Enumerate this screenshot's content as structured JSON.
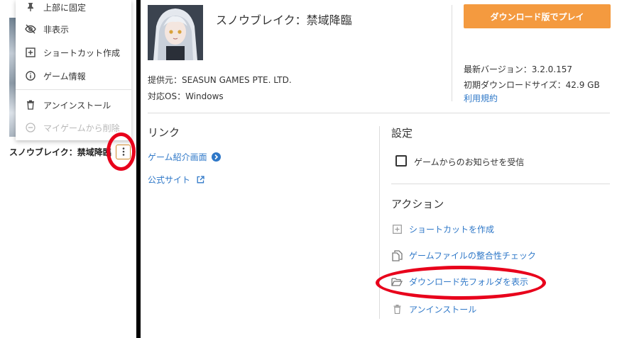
{
  "context_menu": {
    "items": [
      {
        "label": "上部に固定",
        "icon": "pin-icon",
        "disabled": false
      },
      {
        "label": "非表示",
        "icon": "eye-off-icon",
        "disabled": false
      },
      {
        "label": "ショートカット作成",
        "icon": "plus-square-icon",
        "disabled": false
      },
      {
        "label": "ゲーム情報",
        "icon": "info-icon",
        "disabled": false
      },
      {
        "label": "アンインストール",
        "icon": "trash-icon",
        "disabled": false
      },
      {
        "label": "マイゲームから削除",
        "icon": "minus-circle-icon",
        "disabled": true
      }
    ]
  },
  "sidebar": {
    "game_name": "スノウブレイク：禁域降臨",
    "more_icon": "vertical-dots-icon"
  },
  "game": {
    "title": "スノウブレイク：禁域降臨",
    "provider": "提供元：SEASUN GAMES PTE. LTD.",
    "os": "対応OS：Windows",
    "play_label": "ダウンロード版でプレイ",
    "version": "最新バージョン：3.2.0.157",
    "download_size": "初期ダウンロードサイズ：42.9 GB",
    "terms": "利用規約"
  },
  "links": {
    "title": "リンク",
    "game_intro": "ゲーム紹介画面",
    "official_site": "公式サイト"
  },
  "settings": {
    "title": "設定",
    "notify_label": "ゲームからのお知らせを受信",
    "notify_checked": false
  },
  "actions": {
    "title": "アクション",
    "items": [
      {
        "label": "ショートカットを作成",
        "icon": "plus-square-icon"
      },
      {
        "label": "ゲームファイルの整合性チェック",
        "icon": "copy-files-icon"
      },
      {
        "label": "ダウンロード先フォルダを表示",
        "icon": "folder-open-icon"
      },
      {
        "label": "アンインストール",
        "icon": "trash-icon"
      }
    ]
  },
  "colors": {
    "accent": "#f49a3f",
    "link": "#2f78c8",
    "annotation": "#e8001b"
  }
}
